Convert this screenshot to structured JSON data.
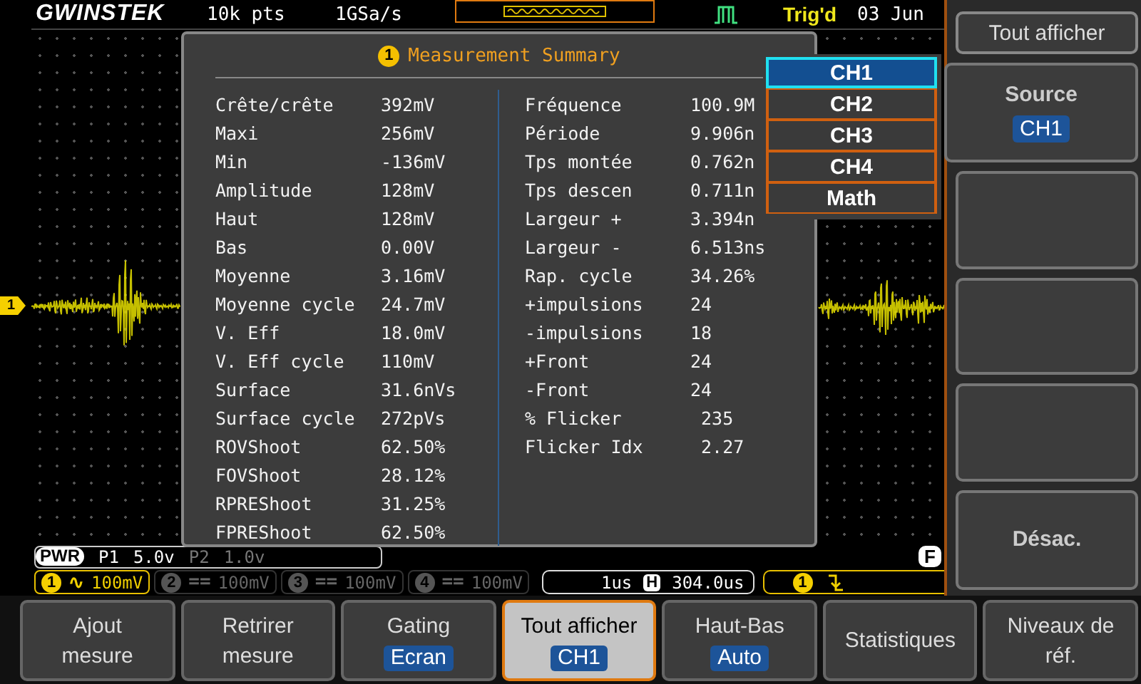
{
  "header": {
    "logo": "GWINSTEK",
    "record_length": "10k pts",
    "sample_rate": "1GSa/s",
    "trigger_status": "Trig'd",
    "date": "03 Jun"
  },
  "channel_marker": "1",
  "summary": {
    "icon": "1",
    "title": "Measurement Summary",
    "left": [
      {
        "label": "Crête/crête",
        "value": "392mV"
      },
      {
        "label": "Maxi",
        "value": "256mV"
      },
      {
        "label": "Min",
        "value": "-136mV"
      },
      {
        "label": "Amplitude",
        "value": "128mV"
      },
      {
        "label": "Haut",
        "value": "128mV"
      },
      {
        "label": "Bas",
        "value": "0.00V"
      },
      {
        "label": "Moyenne",
        "value": "3.16mV"
      },
      {
        "label": "Moyenne cycle",
        "value": "24.7mV"
      },
      {
        "label": "V. Eff",
        "value": "18.0mV"
      },
      {
        "label": "V. Eff cycle",
        "value": "110mV"
      },
      {
        "label": "Surface",
        "value": "31.6nVs"
      },
      {
        "label": "Surface cycle",
        "value": "272pVs"
      },
      {
        "label": "ROVShoot",
        "value": "62.50%"
      },
      {
        "label": "FOVShoot",
        "value": "28.12%"
      },
      {
        "label": "RPREShoot",
        "value": "31.25%"
      },
      {
        "label": "FPREShoot",
        "value": "62.50%"
      }
    ],
    "right": [
      {
        "label": "Fréquence",
        "value": "100.9M"
      },
      {
        "label": "Période",
        "value": "9.906n"
      },
      {
        "label": "Tps montée",
        "value": "0.762n"
      },
      {
        "label": "Tps descen",
        "value": "0.711n"
      },
      {
        "label": "Largeur +",
        "value": "3.394n"
      },
      {
        "label": "Largeur -",
        "value": "6.513ns"
      },
      {
        "label": "Rap. cycle",
        "value": "34.26%"
      },
      {
        "label": "+impulsions",
        "value": "24"
      },
      {
        "label": "-impulsions",
        "value": "18"
      },
      {
        "label": "+Front",
        "value": "24"
      },
      {
        "label": "-Front",
        "value": "24"
      },
      {
        "label": "% Flicker",
        "value": " 235"
      },
      {
        "label": "Flicker Idx",
        "value": " 2.27"
      }
    ]
  },
  "source_menu": [
    {
      "label": "CH1",
      "selected": true
    },
    {
      "label": "CH2",
      "selected": false
    },
    {
      "label": "CH3",
      "selected": false
    },
    {
      "label": "CH4",
      "selected": false
    },
    {
      "label": "Math",
      "selected": false
    }
  ],
  "side_menu": {
    "title": "Tout afficher",
    "items": [
      {
        "kind": "option",
        "label": "Source",
        "value": "CH1"
      },
      {
        "kind": "blank"
      },
      {
        "kind": "blank"
      },
      {
        "kind": "blank"
      },
      {
        "kind": "button",
        "label": "Désac."
      }
    ]
  },
  "probe_bar": {
    "badge": "PWR",
    "items": [
      {
        "label": "P1",
        "value": "5.0v",
        "active": true
      },
      {
        "label": "P2",
        "value": "1.0v",
        "active": false
      }
    ],
    "f_badge": "F"
  },
  "channels": [
    {
      "number": "1",
      "coupling": "∿",
      "scale": "100mV",
      "on": true
    },
    {
      "number": "2",
      "coupling": "==",
      "scale": "100mV",
      "on": false
    },
    {
      "number": "3",
      "coupling": "==",
      "scale": "100mV",
      "on": false
    },
    {
      "number": "4",
      "coupling": "==",
      "scale": "100mV",
      "on": false
    }
  ],
  "timebase": {
    "scale": "1us",
    "badge": "H",
    "position": "304.0us"
  },
  "trigger": {
    "source": "1"
  },
  "softkeys": [
    {
      "label": "Ajout\nmesure",
      "selected": false
    },
    {
      "label": "Retrirer\nmesure",
      "selected": false
    },
    {
      "label": "Gating",
      "value": "Ecran",
      "selected": false
    },
    {
      "label": "Tout afficher",
      "value": "CH1",
      "selected": true
    },
    {
      "label": "Haut-Bas",
      "value": "Auto",
      "selected": false
    },
    {
      "label": "Statistiques",
      "selected": false
    },
    {
      "label": "Niveaux de\nréf.",
      "selected": false
    }
  ]
}
